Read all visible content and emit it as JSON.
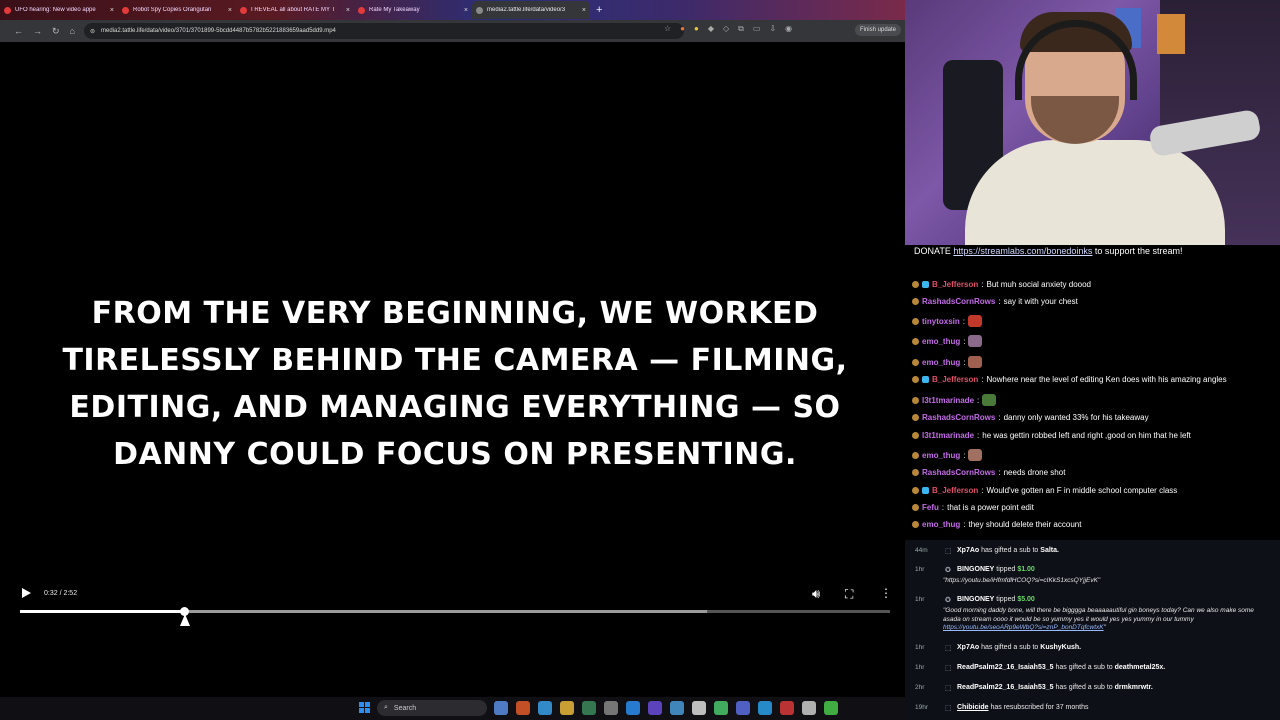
{
  "browser": {
    "tabs": [
      {
        "label": "UFO hearing: New video appe",
        "favicon_color": "#e33b3b"
      },
      {
        "label": "Robot Spy Copies Orangutan",
        "favicon_color": "#e33b3b"
      },
      {
        "label": "I REVEAL all about RATE MY T",
        "favicon_color": "#e33b3b"
      },
      {
        "label": "Rate My Takeaway",
        "favicon_color": "#e33b3b"
      },
      {
        "label": "media2.tattle.life/data/video/3",
        "favicon_color": "#8a8a8a"
      }
    ],
    "new_tab": "+",
    "close": "×",
    "url": "media2.tattle.life/data/video/3701/3701899-5bcdd4487b5782b5221883659aad5dd9.mp4",
    "update_label": "Finish update",
    "window_controls": [
      "—",
      "□",
      "✕"
    ]
  },
  "video": {
    "caption_lines": [
      "FROM THE VERY BEGINNING, WE WORKED",
      "TIRELESSLY BEHIND THE CAMERA — FILMING,",
      "EDITING, AND MANAGING EVERYTHING — SO",
      "DANNY COULD FOCUS ON PRESENTING."
    ],
    "time_display": "0:32 / 2:52",
    "played_fraction": 0.188,
    "buffered_fraction": 0.79,
    "icons": {
      "play": "play-icon",
      "volume": "volume-icon",
      "fullscreen": "fullscreen-icon",
      "more": "more-vertical-icon"
    }
  },
  "taskbar": {
    "search_placeholder": "Search",
    "app_colors": [
      "#5a8ee0",
      "#e35a2a",
      "#38a0e8",
      "#e8b83a",
      "#3c8a5a",
      "#888",
      "#2b8ef0",
      "#6a4bd8",
      "#4a9bd8",
      "#ddd",
      "#4ac86a",
      "#5a6ee0",
      "#2ba0e8",
      "#d83a3a",
      "#ccc",
      "#4ac84a"
    ]
  },
  "stream": {
    "donate_prefix": "DONATE ",
    "donate_link": "https://streamlabs.com/bonedoinks",
    "donate_suffix": " to support the stream!"
  },
  "chat": [
    {
      "user": "B_Jefferson",
      "color": "#e0506a",
      "sub": true,
      "msg": "But muh social anxiety doood"
    },
    {
      "user": "RashadsCornRows",
      "color": "#c46ce8",
      "sub": false,
      "msg": "say it with your chest"
    },
    {
      "user": "tinytoxsin",
      "color": "#c46ce8",
      "sub": false,
      "msg": "",
      "emote": "#c0392b"
    },
    {
      "user": "emo_thug",
      "color": "#c46ce8",
      "sub": false,
      "msg": "",
      "emote": "#8a6a8a"
    },
    {
      "user": "emo_thug",
      "color": "#c46ce8",
      "sub": false,
      "msg": "",
      "emote": "#a06050"
    },
    {
      "user": "B_Jefferson",
      "color": "#e0506a",
      "sub": true,
      "msg": "Nowhere near the level of editing Ken does with his amazing angles"
    },
    {
      "user": "l3t1tmarinade",
      "color": "#c46ce8",
      "sub": false,
      "msg": "",
      "emote": "#4a7a3a"
    },
    {
      "user": "RashadsCornRows",
      "color": "#c46ce8",
      "sub": false,
      "msg": "danny only wanted 33% for his takeaway"
    },
    {
      "user": "l3t1tmarinade",
      "color": "#c46ce8",
      "sub": false,
      "msg": "he was gettin robbed left and right ,good on him that he left"
    },
    {
      "user": "emo_thug",
      "color": "#c46ce8",
      "sub": false,
      "msg": "",
      "emote": "#a07060"
    },
    {
      "user": "RashadsCornRows",
      "color": "#c46ce8",
      "sub": false,
      "msg": "needs drone shot"
    },
    {
      "user": "B_Jefferson",
      "color": "#e0506a",
      "sub": true,
      "msg": "Would've gotten an F in middle school computer class"
    },
    {
      "user": "Fefu",
      "color": "#c46ce8",
      "sub": false,
      "msg": "that is a power point edit"
    },
    {
      "user": "emo_thug",
      "color": "#c46ce8",
      "sub": false,
      "msg": "they should delete their account"
    }
  ],
  "events": [
    {
      "time": "44m",
      "text_user": "Xp7Ao",
      "text_mid": " has gifted a sub to ",
      "text_target": "Salta."
    },
    {
      "time": "1hr",
      "text_user": "BINGONEY",
      "text_mid": " tipped ",
      "amount": "$1.00",
      "note": "\"https://youtu.be/iHfmfdlHCOQ?si=cIKkS1xcsQYjjEvK\""
    },
    {
      "time": "1hr",
      "text_user": "BINGONEY",
      "text_mid": " tipped ",
      "amount": "$5.00",
      "note": "\"Good morning daddy bone, will there be bigggga beaaaaautiful gin boneys today? Can we also make some asada on stream oooo it would be so yummy yes it would yes yes yummy in our tummy ",
      "note_link": "https://youtu.be/seoARp9eWbQ?si=znP_bonDTqfcwtxK",
      "note_end": "\""
    },
    {
      "time": "1hr",
      "text_user": "Xp7Ao",
      "text_mid": " has gifted a sub to ",
      "text_target": "KushyKush."
    },
    {
      "time": "1hr",
      "text_user": "ReadPsalm22_16_Isaiah53_5",
      "text_mid": " has gifted a sub to ",
      "text_target": "deathmetal25x."
    },
    {
      "time": "2hr",
      "text_user": "ReadPsalm22_16_Isaiah53_5",
      "text_mid": " has gifted a sub to ",
      "text_target": "drmkmrwtr."
    },
    {
      "time": "19hr",
      "text_user": "Chibicide",
      "text_mid": " has resubscribed for 37 months",
      "text_target": ""
    }
  ]
}
